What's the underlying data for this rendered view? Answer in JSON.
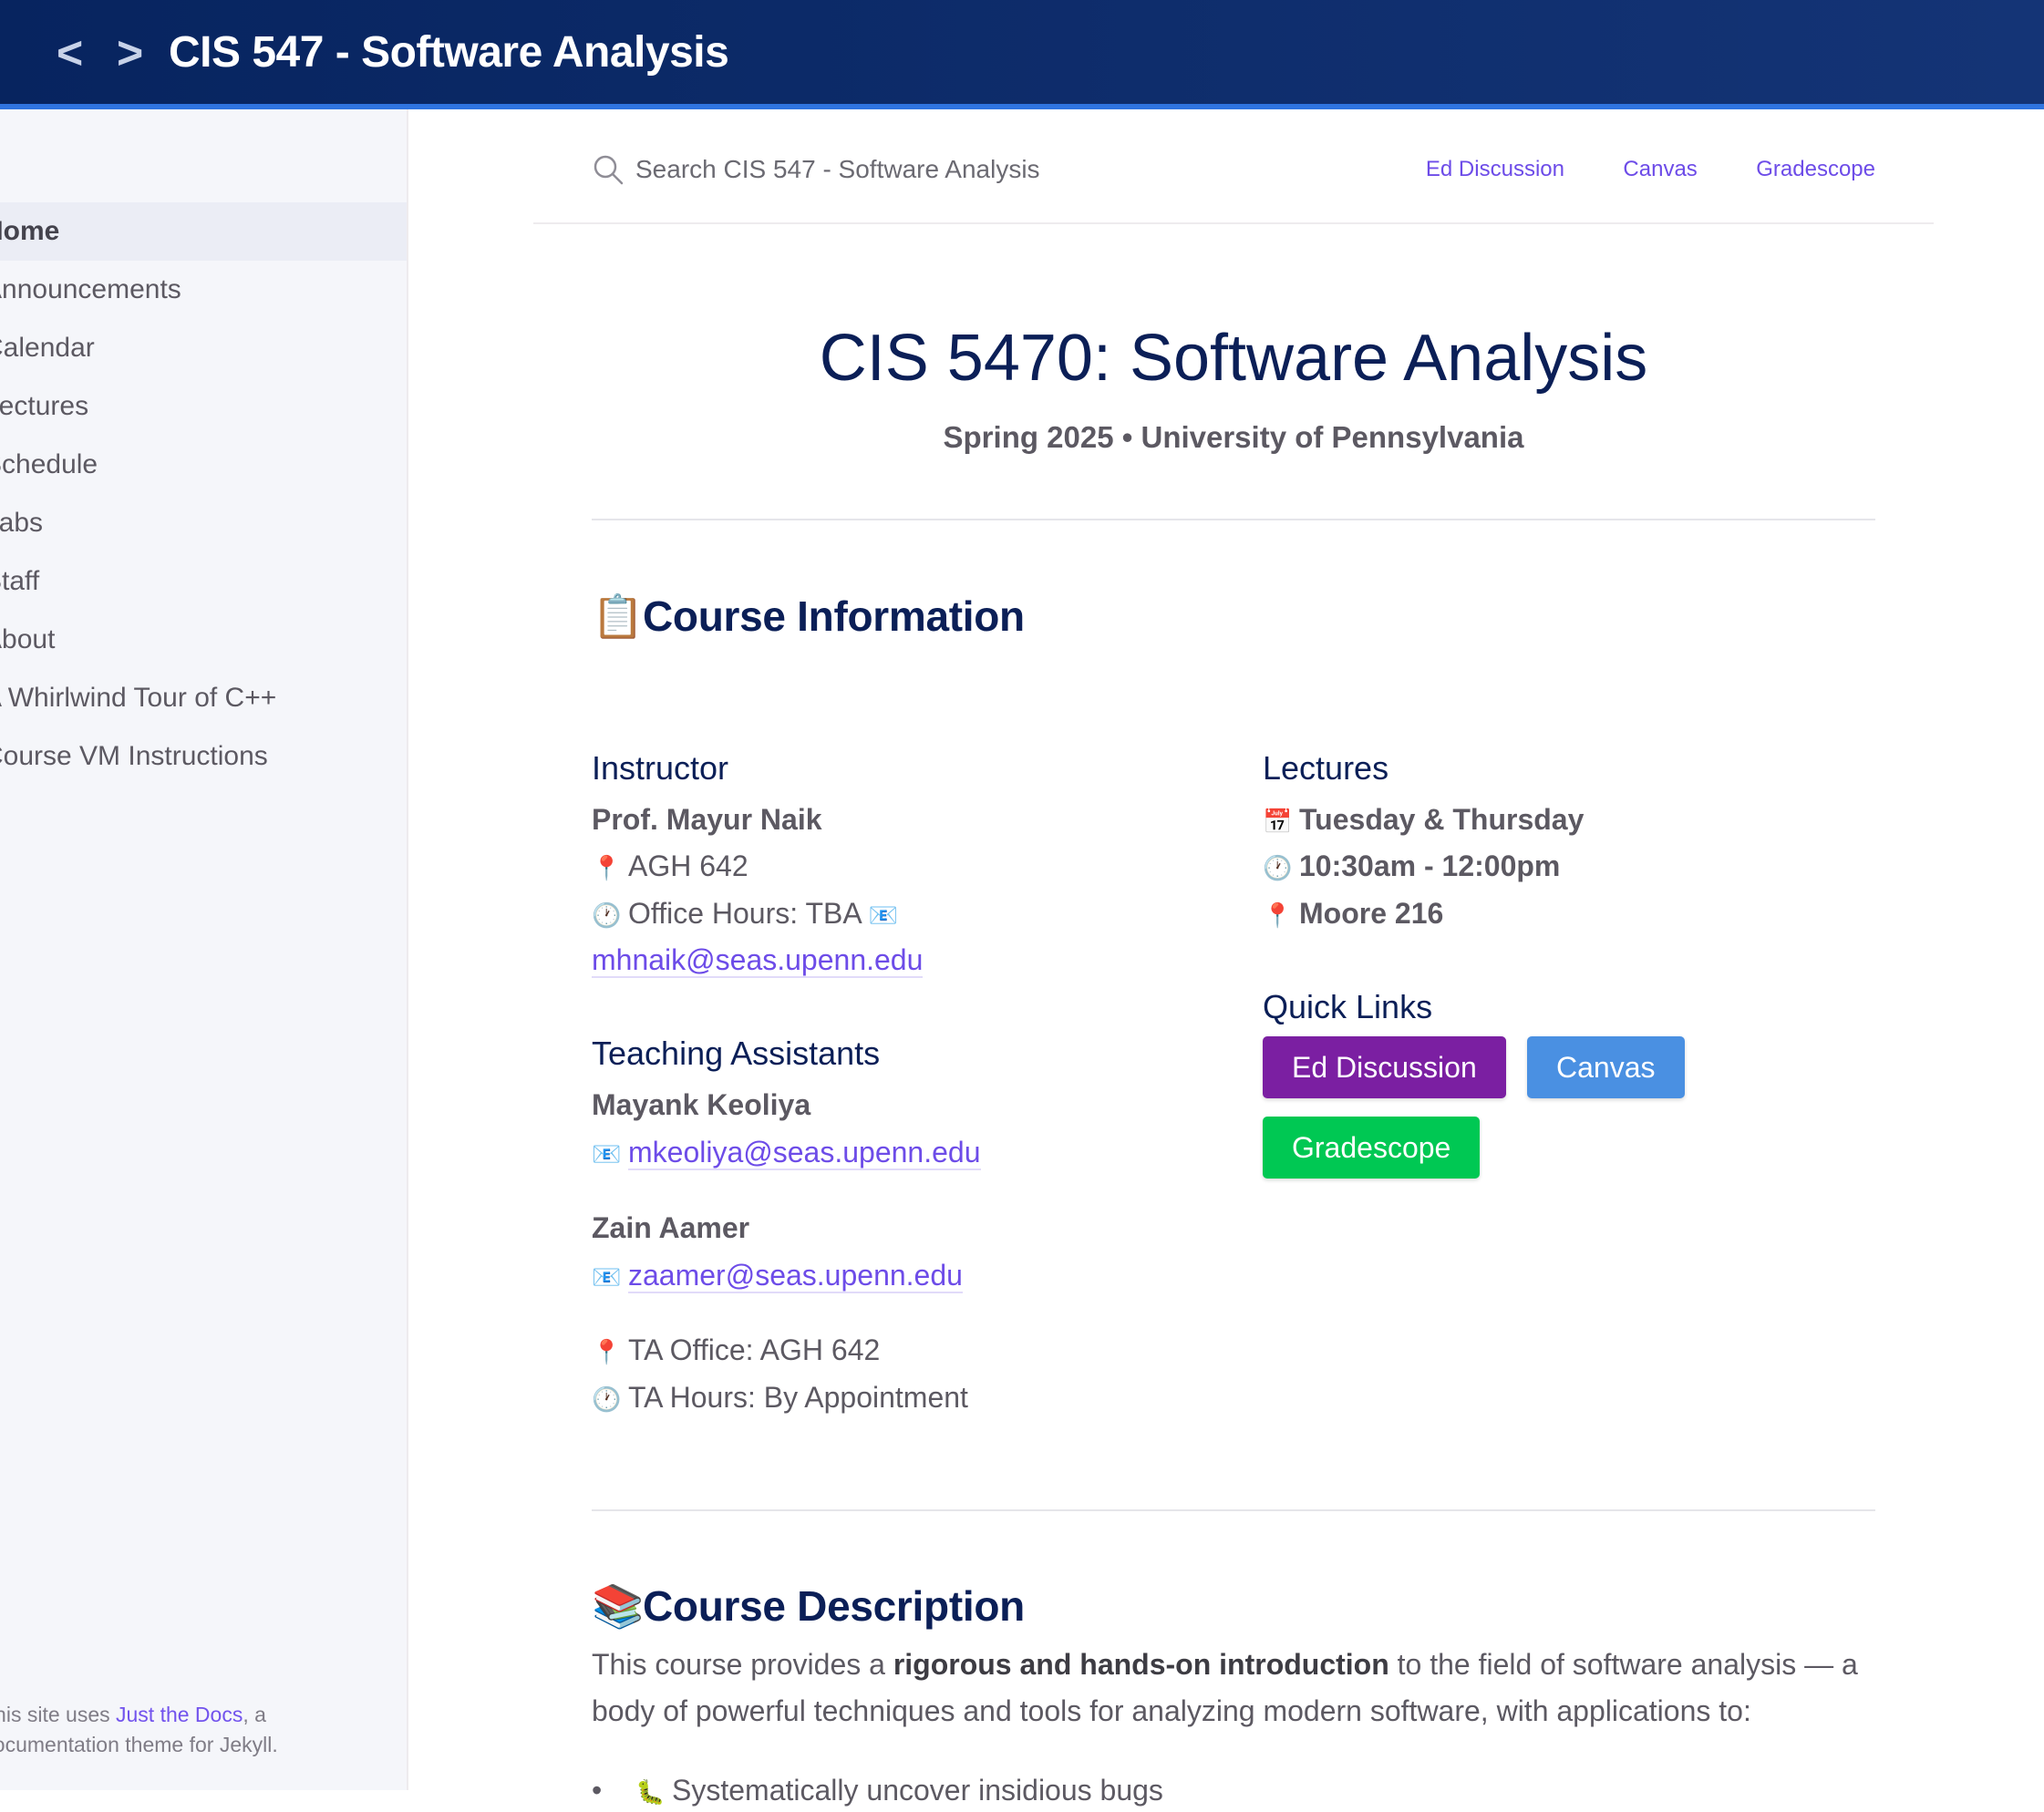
{
  "header": {
    "back_glyph": "<",
    "forward_glyph": ">",
    "title": "CIS 547 - Software Analysis"
  },
  "sidebar": {
    "items": [
      {
        "label": "Home",
        "active": true
      },
      {
        "label": "Announcements"
      },
      {
        "label": "Calendar"
      },
      {
        "label": "Lectures"
      },
      {
        "label": "Schedule"
      },
      {
        "label": "Labs"
      },
      {
        "label": "Staff"
      },
      {
        "label": "About"
      },
      {
        "label": "A Whirlwind Tour of C++"
      },
      {
        "label": "Course VM Instructions"
      }
    ],
    "footer": {
      "prefix": "This site uses ",
      "link": "Just the Docs",
      "suffix": ", a documentation theme for Jekyll."
    }
  },
  "search": {
    "icon": "search-icon",
    "placeholder": "Search CIS 547 - Software Analysis"
  },
  "aux_links": [
    "Ed Discussion",
    "Canvas",
    "Gradescope"
  ],
  "hero": {
    "title": "CIS 5470: Software Analysis",
    "subtitle": "Spring 2025 • University of Pennsylvania"
  },
  "course_info": {
    "emoji": "📋",
    "title": "Course Information",
    "instructor": {
      "heading": "Instructor",
      "name": "Prof. Mayur Naik",
      "pin": "📍",
      "office": "AGH 642",
      "clock": "🕐",
      "hours": "Office Hours: TBA",
      "mail": "📧",
      "email": "mhnaik@seas.upenn.edu"
    },
    "tas": {
      "heading": "Teaching Assistants",
      "people": [
        {
          "name": "Mayank Keoliya",
          "mail": "📧",
          "email": "mkeoliya@seas.upenn.edu"
        },
        {
          "name": "Zain Aamer",
          "mail": "📧",
          "email": "zaamer@seas.upenn.edu"
        }
      ],
      "pin": "📍",
      "office": "TA Office: AGH 642",
      "clock": "🕐",
      "hours": "TA Hours: By Appointment"
    },
    "lectures": {
      "heading": "Lectures",
      "cal": "📅",
      "days": "Tuesday & Thursday",
      "clock": "🕐",
      "time": "10:30am - 12:00pm",
      "pin": "📍",
      "room": "Moore 216"
    },
    "quick_links": {
      "heading": "Quick Links",
      "buttons": [
        {
          "label": "Ed Discussion",
          "color": "#7b1fa2"
        },
        {
          "label": "Canvas",
          "color": "#4a90e2"
        },
        {
          "label": "Gradescope",
          "color": "#00c853"
        }
      ]
    }
  },
  "course_desc": {
    "emoji": "📚",
    "title": "Course Description",
    "p_start": "This course provides a ",
    "p_bold": "rigorous and hands-on introduction",
    "p_end": " to the field of software analysis — a body of powerful techniques and tools for analyzing modern software, with applications to:",
    "first_bullet_icon": "🐛",
    "first_bullet": "Systematically uncover insidious bugs"
  }
}
